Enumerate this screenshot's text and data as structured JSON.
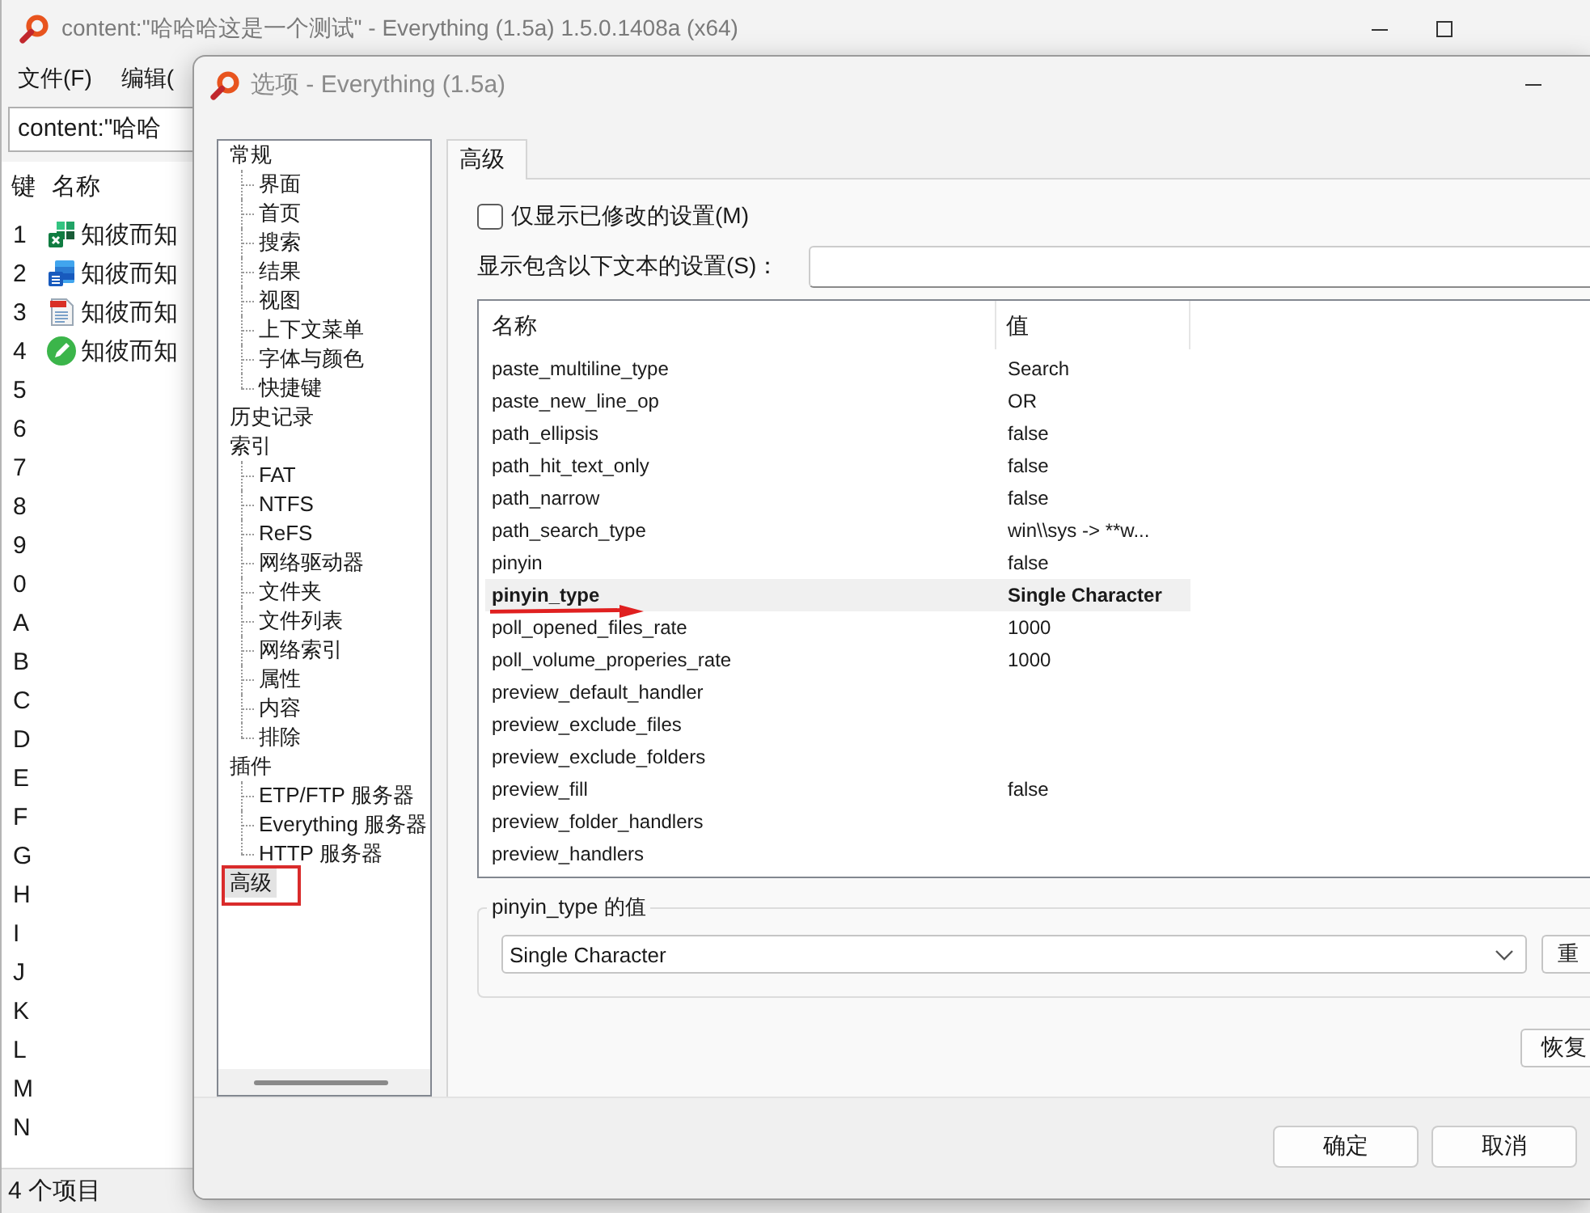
{
  "main_window": {
    "title": "content:\"哈哈哈这是一个测试\" - Everything (1.5a) 1.5.0.1408a (x64)",
    "menu": [
      "文件(F)",
      "编辑("
    ],
    "search": {
      "value": "content:\"哈哈"
    },
    "columns": [
      "键",
      "名称"
    ],
    "rows": [
      {
        "key": "1",
        "name": "知彼而知",
        "kind": "spreadsheet"
      },
      {
        "key": "2",
        "name": "知彼而知",
        "kind": "document"
      },
      {
        "key": "3",
        "name": "知彼而知",
        "kind": "pdf"
      },
      {
        "key": "4",
        "name": "知彼而知",
        "kind": "note"
      },
      {
        "key": "5"
      },
      {
        "key": "6"
      },
      {
        "key": "7"
      },
      {
        "key": "8"
      },
      {
        "key": "9"
      },
      {
        "key": "0"
      },
      {
        "key": "A"
      },
      {
        "key": "B"
      },
      {
        "key": "C"
      },
      {
        "key": "D"
      },
      {
        "key": "E"
      },
      {
        "key": "F"
      },
      {
        "key": "G"
      },
      {
        "key": "H"
      },
      {
        "key": "I"
      },
      {
        "key": "J"
      },
      {
        "key": "K"
      },
      {
        "key": "L"
      },
      {
        "key": "M"
      },
      {
        "key": "N"
      }
    ],
    "status_bar": "4 个项目"
  },
  "dialog": {
    "title": "选项 - Everything (1.5a)",
    "tree": [
      {
        "label": "常规",
        "selected": false,
        "annotated": false,
        "children": [
          {
            "label": "界面",
            "selected": false,
            "annotated": false
          },
          {
            "label": "首页",
            "selected": false,
            "annotated": false
          },
          {
            "label": "搜索",
            "selected": false,
            "annotated": false
          },
          {
            "label": "结果",
            "selected": false,
            "annotated": false
          },
          {
            "label": "视图",
            "selected": false,
            "annotated": false
          },
          {
            "label": "上下文菜单",
            "selected": false,
            "annotated": false
          },
          {
            "label": "字体与颜色",
            "selected": false,
            "annotated": false
          },
          {
            "label": "快捷键",
            "selected": false,
            "annotated": false
          }
        ]
      },
      {
        "label": "历史记录",
        "selected": false,
        "annotated": false
      },
      {
        "label": "索引",
        "selected": false,
        "annotated": false,
        "children": [
          {
            "label": "FAT",
            "selected": false,
            "annotated": false
          },
          {
            "label": "NTFS",
            "selected": false,
            "annotated": false
          },
          {
            "label": "ReFS",
            "selected": false,
            "annotated": false
          },
          {
            "label": "网络驱动器",
            "selected": false,
            "annotated": false
          },
          {
            "label": "文件夹",
            "selected": false,
            "annotated": false
          },
          {
            "label": "文件列表",
            "selected": false,
            "annotated": false
          },
          {
            "label": "网络索引",
            "selected": false,
            "annotated": false
          },
          {
            "label": "属性",
            "selected": false,
            "annotated": false
          },
          {
            "label": "内容",
            "selected": false,
            "annotated": false
          },
          {
            "label": "排除",
            "selected": false,
            "annotated": false
          }
        ]
      },
      {
        "label": "插件",
        "selected": false,
        "annotated": false,
        "children": [
          {
            "label": "ETP/FTP 服务器",
            "selected": false,
            "annotated": false
          },
          {
            "label": "Everything 服务器",
            "selected": false,
            "annotated": false
          },
          {
            "label": "HTTP 服务器",
            "selected": false,
            "annotated": false
          }
        ]
      },
      {
        "label": "高级",
        "selected": true,
        "annotated": true
      }
    ],
    "tabs": [
      {
        "label": "高级",
        "selected": true
      }
    ],
    "show_modified_only": {
      "label": "仅显示已修改的设置(M)",
      "checked": false
    },
    "filter": {
      "label": "显示包含以下文本的设置(S)："
    },
    "table": {
      "columns": [
        "名称",
        "值"
      ],
      "rows": [
        {
          "name": "paste_multiline_type",
          "value": "Search",
          "selected": false,
          "annotated": false
        },
        {
          "name": "paste_new_line_op",
          "value": "OR",
          "selected": false,
          "annotated": false
        },
        {
          "name": "path_ellipsis",
          "value": "false",
          "selected": false,
          "annotated": false
        },
        {
          "name": "path_hit_text_only",
          "value": "false",
          "selected": false,
          "annotated": false
        },
        {
          "name": "path_narrow",
          "value": "false",
          "selected": false,
          "annotated": false
        },
        {
          "name": "path_search_type",
          "value": "win\\\\sys -> **w...",
          "selected": false,
          "annotated": false
        },
        {
          "name": "pinyin",
          "value": "false",
          "selected": false,
          "annotated": false
        },
        {
          "name": "pinyin_type",
          "value": "Single Character",
          "selected": true,
          "annotated": true
        },
        {
          "name": "poll_opened_files_rate",
          "value": "1000",
          "selected": false,
          "annotated": false
        },
        {
          "name": "poll_volume_properies_rate",
          "value": "1000",
          "selected": false,
          "annotated": false
        },
        {
          "name": "preview_default_handler",
          "selected": false,
          "annotated": false
        },
        {
          "name": "preview_exclude_files",
          "selected": false,
          "annotated": false
        },
        {
          "name": "preview_exclude_folders",
          "selected": false,
          "annotated": false
        },
        {
          "name": "preview_fill",
          "value": "false",
          "selected": false,
          "annotated": false
        },
        {
          "name": "preview_folder_handlers",
          "selected": false,
          "annotated": false
        },
        {
          "name": "preview_handlers",
          "selected": false,
          "annotated": false
        }
      ]
    },
    "value_group": {
      "label": "pinyin_type 的值",
      "dropdown": {
        "value": "Single Character"
      },
      "button": "重"
    },
    "restore_button": "恢复",
    "buttons": [
      "确定",
      "取消"
    ]
  }
}
